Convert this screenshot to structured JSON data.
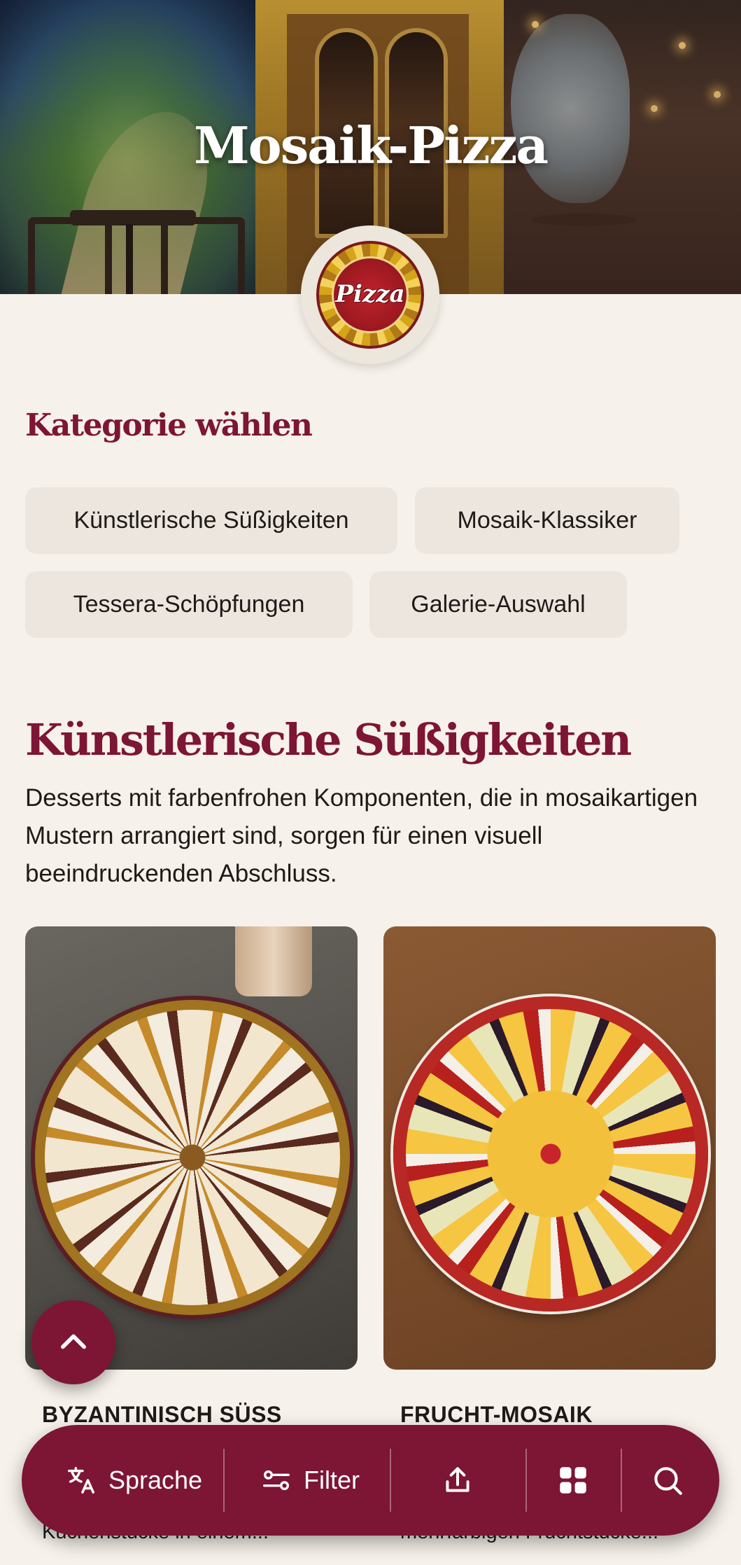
{
  "header": {
    "title": "Mosaik-Pizza",
    "logo_text": "Pizza"
  },
  "categories": {
    "heading": "Kategorie wählen",
    "items": [
      {
        "label": "Künstlerische Süßigkeiten"
      },
      {
        "label": "Mosaik-Klassiker"
      },
      {
        "label": "Tessera-Schöpfungen"
      },
      {
        "label": "Galerie-Auswahl"
      }
    ]
  },
  "section": {
    "title": "Künstlerische Süßigkeiten",
    "description": "Desserts mit farbenfrohen Komponenten, die in mosaikartigen Mustern arrangiert sind, sorgen für einen visuell beeindruckenden Abschluss.",
    "cards": [
      {
        "title": "BYZANTINISCH SÜSS",
        "subtitle": "Kuchenstücke in einem..."
      },
      {
        "title": "FRUCHT-MOSAIK",
        "subtitle": "mehrfarbigen Fruchtstücke..."
      }
    ]
  },
  "toolbar": {
    "language_label": "Sprache",
    "filter_label": "Filter",
    "share_icon": "share-icon",
    "grid_icon": "grid-icon",
    "search_icon": "search-icon"
  },
  "colors": {
    "accent": "#7d1535",
    "background": "#f6f1ea",
    "chip": "#ece6df"
  }
}
